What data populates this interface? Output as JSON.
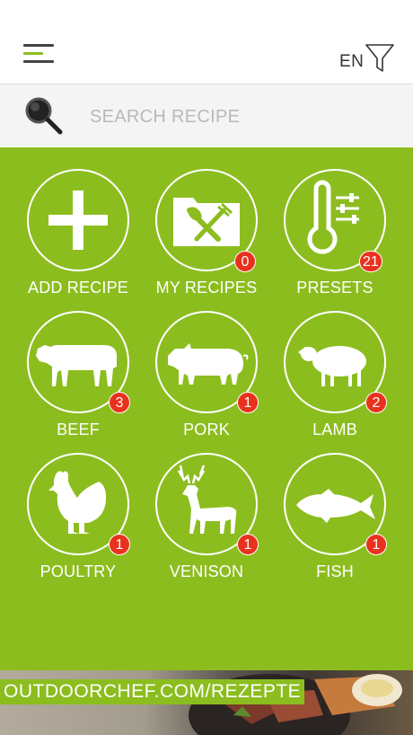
{
  "header": {
    "menu_icon": "hamburger-menu-icon",
    "language": "EN",
    "filter_icon": "funnel-filter-icon"
  },
  "search": {
    "icon": "magnifier-icon",
    "placeholder": "SEARCH RECIPE"
  },
  "tiles": [
    {
      "label": "ADD RECIPE",
      "icon": "plus-icon",
      "badge": ""
    },
    {
      "label": "MY RECIPES",
      "icon": "folder-fork-knife-icon",
      "badge": "0"
    },
    {
      "label": "PRESETS",
      "icon": "thermometer-sliders-icon",
      "badge": "21"
    },
    {
      "label": "BEEF",
      "icon": "cow-icon",
      "badge": "3"
    },
    {
      "label": "PORK",
      "icon": "pig-icon",
      "badge": "1"
    },
    {
      "label": "LAMB",
      "icon": "sheep-icon",
      "badge": "2"
    },
    {
      "label": "POULTRY",
      "icon": "chicken-icon",
      "badge": "1"
    },
    {
      "label": "VENISON",
      "icon": "deer-icon",
      "badge": "1"
    },
    {
      "label": "FISH",
      "icon": "fish-icon",
      "badge": "1"
    }
  ],
  "banner": {
    "text": "OUTDOORCHEF.COM/REZEPTE"
  },
  "colors": {
    "accent_green": "#8cbd1f",
    "badge_red": "#e8321e"
  }
}
